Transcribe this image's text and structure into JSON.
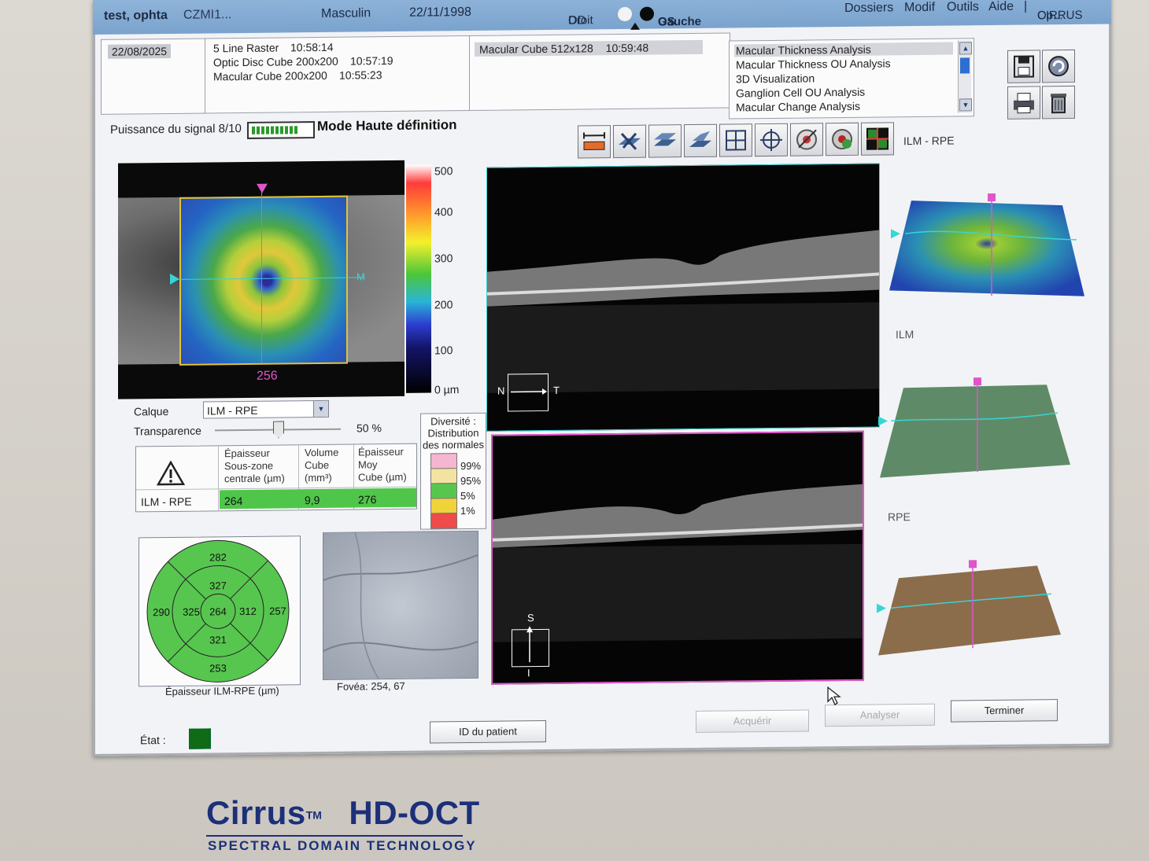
{
  "titlebar": {
    "patient_name": "test, ophta",
    "patient_id": "CZMI1...",
    "sex": "Masculin",
    "dob": "22/11/1998",
    "od_code": "OD",
    "od_label": "Droit",
    "os_code": "OS",
    "os_label": "Gauche"
  },
  "menu": {
    "items": [
      "Dossiers",
      "Modif",
      "Outils",
      "Aide"
    ],
    "separator": "|",
    "brand_line1": "CIRRUS",
    "brand_line2": "Op..."
  },
  "visits": {
    "date": "22/08/2025",
    "scans_left": [
      {
        "name": "5 Line Raster",
        "time": "10:58:14"
      },
      {
        "name": "Optic Disc Cube 200x200",
        "time": "10:57:19"
      },
      {
        "name": "Macular Cube 200x200",
        "time": "10:55:23"
      }
    ],
    "scan_selected": {
      "name": "Macular Cube 512x128",
      "time": "10:59:48"
    }
  },
  "analyses": {
    "items": [
      "Macular Thickness Analysis",
      "Macular Thickness OU Analysis",
      "3D Visualization",
      "Ganglion Cell OU Analysis",
      "Macular Change Analysis"
    ],
    "selected_index": 0
  },
  "toolbar": {
    "icons": [
      "ruler-icon",
      "flatten-icon",
      "layer-slab-icon",
      "slab-edit-icon",
      "grid-icon",
      "crosshair-icon",
      "fundus-overlay-icon",
      "rotate-view-icon",
      "split-view-icon"
    ],
    "file_icons": [
      "save-icon",
      "undo-icon",
      "print-icon",
      "delete-icon"
    ]
  },
  "signal": {
    "label": "Puissance du signal 8/10",
    "strength": 0.8,
    "hd_mode": "Mode Haute définition"
  },
  "thickness_map": {
    "center_value": "256",
    "right_label": "M",
    "scale_labels": [
      "500",
      "400",
      "300",
      "200",
      "100",
      "0 µm"
    ]
  },
  "controls": {
    "calque_label": "Calque",
    "calque_value": "ILM - RPE",
    "transparence_label": "Transparence",
    "transparence_value": "50 %",
    "transparence_level": 0.5
  },
  "measurements": {
    "headers": [
      [
        "Épaisseur",
        "Sous-zone",
        "centrale (µm)"
      ],
      [
        "Volume",
        "Cube",
        "(mm³)"
      ],
      [
        "Épaisseur",
        "Moy",
        "Cube (µm)"
      ]
    ],
    "row_label": "ILM - RPE",
    "values": [
      "264",
      "9,9",
      "276"
    ]
  },
  "normals_legend": {
    "title": [
      "Diversité :",
      "Distribution",
      "des normales"
    ],
    "entries": [
      {
        "label": "99%",
        "color": "#f4b6d0"
      },
      {
        "label": "95%",
        "color": "#f3e3a0"
      },
      {
        "label": "5%",
        "color": "#57c64f"
      },
      {
        "label": "1%",
        "color": "#f0d23a"
      },
      {
        "label": "",
        "color": "#ee4b4b"
      }
    ]
  },
  "etdrs": {
    "superior_outer": "282",
    "superior_inner": "327",
    "nasal_outer": "290",
    "nasal_inner": "325",
    "center": "264",
    "temporal_inner": "312",
    "temporal_outer": "257",
    "inferior_inner": "321",
    "inferior_outer": "253",
    "caption": "Épaisseur ILM-RPE (µm)",
    "fill_color": "#57c64f"
  },
  "fovea": {
    "caption": "Fovéa: 254, 67"
  },
  "bscans": {
    "top": {
      "left": "N",
      "right": "T"
    },
    "bottom": {
      "top": "S",
      "bottom": "I"
    }
  },
  "surfaces": {
    "title": "ILM - RPE",
    "ilm_label": "ILM",
    "rpe_label": "RPE"
  },
  "status": {
    "label": "État :",
    "color": "#0f6b16"
  },
  "buttons": {
    "patient_id": "ID du patient",
    "acquire": "Acquérir",
    "analyze": "Analyser",
    "finish": "Terminer"
  },
  "brand": {
    "name_part1": "Cirrus",
    "tm": "TM",
    "name_part2": "HD-OCT",
    "subtitle": "SPECTRAL DOMAIN TECHNOLOGY"
  }
}
